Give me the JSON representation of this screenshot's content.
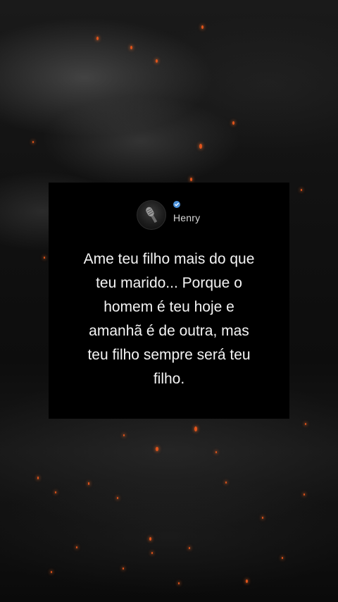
{
  "post": {
    "author": "Henry",
    "verified": true,
    "avatar_icon": "microphone-icon",
    "quote_lines": [
      "Ame teu filho mais do que",
      "teu marido... Porque o",
      "homem é teu hoje e",
      "amanhã é de outra, mas",
      "teu filho sempre será teu",
      "filho."
    ]
  },
  "colors": {
    "card_background": "#000000",
    "text": "#f4f4f4",
    "verified_badge": "#4a90d9",
    "ember": "#e2541b"
  }
}
